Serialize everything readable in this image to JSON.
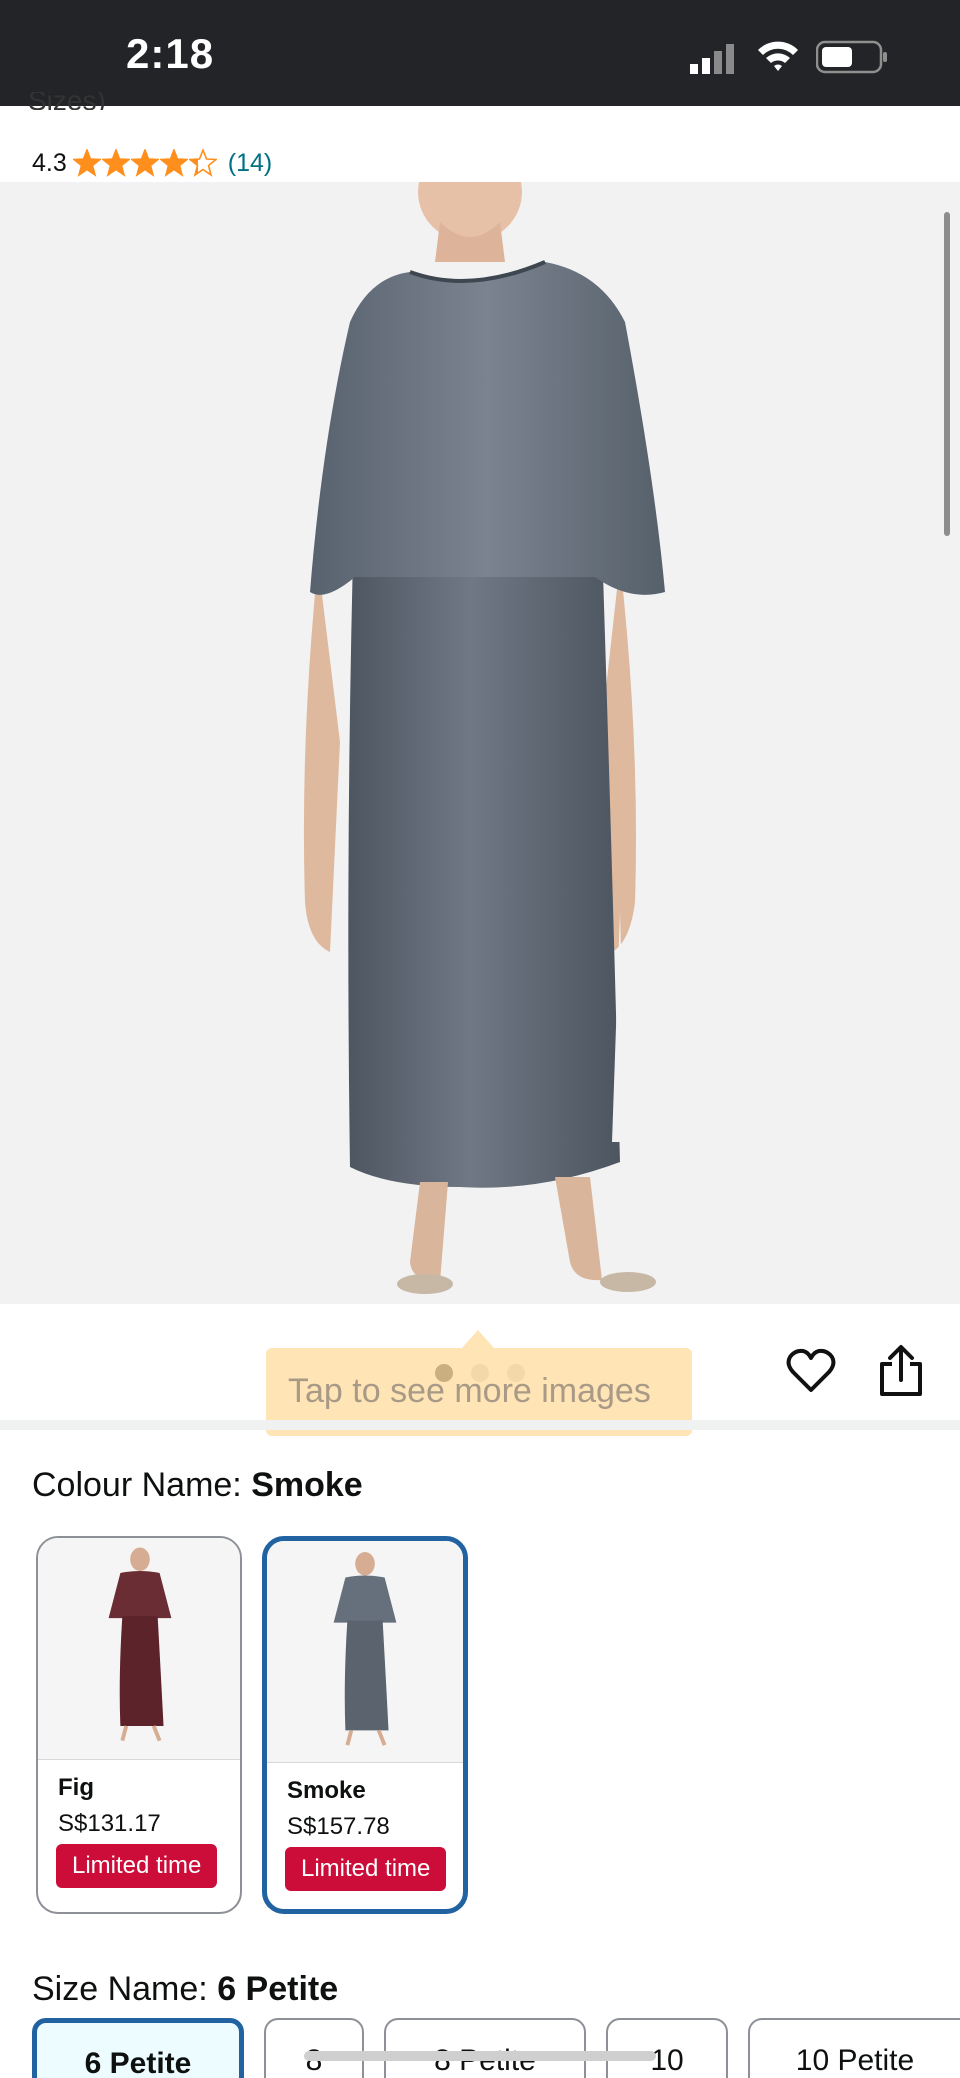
{
  "status_bar": {
    "time": "2:18",
    "icons": [
      "signal-icon",
      "wifi-icon",
      "battery-icon"
    ]
  },
  "product": {
    "title_fragment": "Sizes)",
    "rating": "4.3",
    "stars": 4.3,
    "review_count": "(14)"
  },
  "gallery": {
    "tooltip": "Tap to see more images",
    "dots": 3,
    "active_dot": 0,
    "actions": [
      "heart-icon",
      "share-icon"
    ]
  },
  "colour": {
    "label": "Colour Name: ",
    "selected": "Smoke",
    "options": [
      {
        "name": "Fig",
        "price": "S$131.17",
        "badge": "Limited time"
      },
      {
        "name": "Smoke",
        "price": "S$157.78",
        "badge": "Limited time"
      }
    ]
  },
  "size": {
    "label": "Size Name: ",
    "selected": "6 Petite",
    "options": [
      "6 Petite",
      "8",
      "8 Petite",
      "10",
      "10 Petite"
    ]
  },
  "colors": {
    "star": "#ff8f1c",
    "link": "#007185",
    "selected_border": "#2162a1",
    "deal_badge": "#cc0c39"
  }
}
